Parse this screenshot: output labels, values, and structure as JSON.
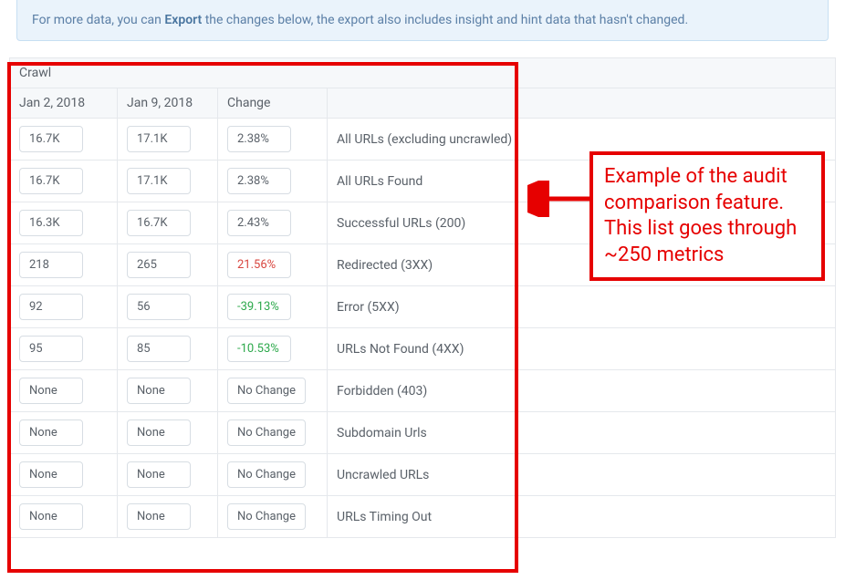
{
  "banner": {
    "pre": "For more data, you can ",
    "strong": "Export",
    "post": " the changes below, the export also includes insight and hint data that hasn't changed."
  },
  "table": {
    "section": "Crawl",
    "headers": {
      "date1": "Jan 2, 2018",
      "date2": "Jan 9, 2018",
      "change": "Change",
      "label": ""
    },
    "rows": [
      {
        "v1": "16.7K",
        "v2": "17.1K",
        "change": "2.38%",
        "changeClass": "",
        "label": "All URLs (excluding uncrawled)"
      },
      {
        "v1": "16.7K",
        "v2": "17.1K",
        "change": "2.38%",
        "changeClass": "",
        "label": "All URLs Found"
      },
      {
        "v1": "16.3K",
        "v2": "16.7K",
        "change": "2.43%",
        "changeClass": "",
        "label": "Successful URLs (200)"
      },
      {
        "v1": "218",
        "v2": "265",
        "change": "21.56%",
        "changeClass": "change-negative",
        "label": "Redirected (3XX)"
      },
      {
        "v1": "92",
        "v2": "56",
        "change": "-39.13%",
        "changeClass": "change-positive",
        "label": "Error (5XX)"
      },
      {
        "v1": "95",
        "v2": "85",
        "change": "-10.53%",
        "changeClass": "change-positive",
        "label": "URLs Not Found (4XX)"
      },
      {
        "v1": "None",
        "v2": "None",
        "change": "No Change",
        "changeClass": "",
        "label": "Forbidden (403)"
      },
      {
        "v1": "None",
        "v2": "None",
        "change": "No Change",
        "changeClass": "",
        "label": "Subdomain Urls"
      },
      {
        "v1": "None",
        "v2": "None",
        "change": "No Change",
        "changeClass": "",
        "label": "Uncrawled URLs"
      },
      {
        "v1": "None",
        "v2": "None",
        "change": "No Change",
        "changeClass": "",
        "label": "URLs Timing Out"
      }
    ]
  },
  "annotation": {
    "text": "Example of the audit comparison feature. This list goes through ~250 metrics"
  }
}
